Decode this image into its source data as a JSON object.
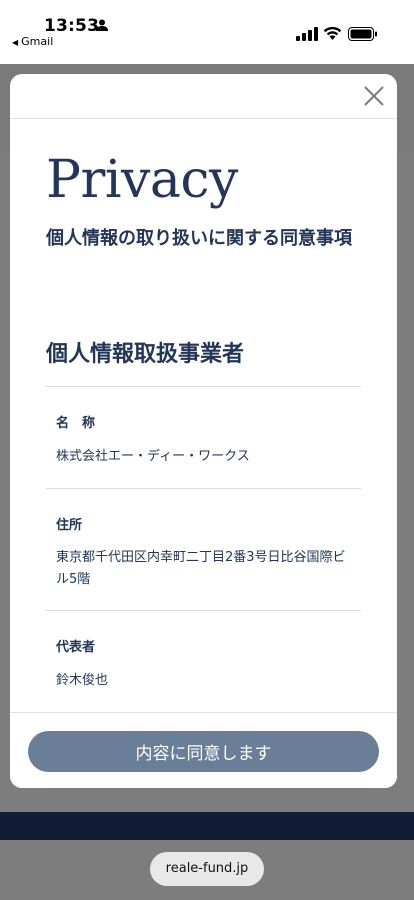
{
  "status_bar": {
    "time": "13:53",
    "back_app": "Gmail"
  },
  "modal": {
    "title_en": "Privacy",
    "title_ja": "個人情報の取り扱いに関する同意事項",
    "section_heading": "個人情報取扱事業者",
    "fields": [
      {
        "label": "名　称",
        "value": "株式会社エー・ディー・ワークス"
      },
      {
        "label": "住所",
        "value": "東京都千代田区内幸町二丁目2番3号日比谷国際ビル5階"
      },
      {
        "label": "代表者",
        "value": "鈴木俊也"
      }
    ],
    "agree_label": "内容に同意します"
  },
  "browser": {
    "url": "reale-fund.jp"
  },
  "colors": {
    "navy_text": "#23365a",
    "button": "#6b7e98",
    "overlay": "#7d7d7d"
  }
}
